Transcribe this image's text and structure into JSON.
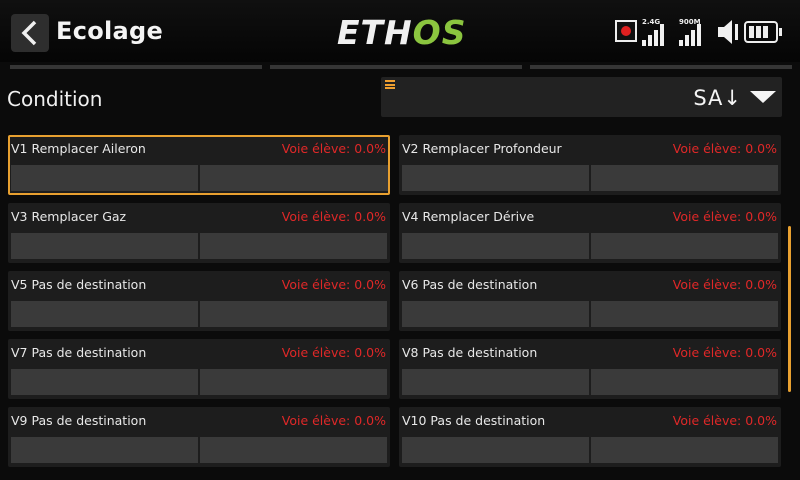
{
  "header": {
    "title": "Ecolage",
    "logo": {
      "main": "ETH",
      "accent": "OS"
    },
    "signal_24": "2.4G",
    "signal_900": "900M"
  },
  "condition": {
    "label": "Condition",
    "value": "SA↓"
  },
  "channels": [
    {
      "name": "V1 Remplacer Aileron",
      "status": "Voie élève: 0.0%"
    },
    {
      "name": "V2 Remplacer Profondeur",
      "status": "Voie élève: 0.0%"
    },
    {
      "name": "V3 Remplacer Gaz",
      "status": "Voie élève: 0.0%"
    },
    {
      "name": "V4 Remplacer Dérive",
      "status": "Voie élève: 0.0%"
    },
    {
      "name": "V5 Pas de destination",
      "status": "Voie élève: 0.0%"
    },
    {
      "name": "V6 Pas de destination",
      "status": "Voie élève: 0.0%"
    },
    {
      "name": "V7 Pas de destination",
      "status": "Voie élève: 0.0%"
    },
    {
      "name": "V8 Pas de destination",
      "status": "Voie élève: 0.0%"
    },
    {
      "name": "V9 Pas de destination",
      "status": "Voie élève: 0.0%"
    },
    {
      "name": "V10 Pas de destination",
      "status": "Voie élève: 0.0%"
    }
  ],
  "colors": {
    "accent": "#e8a030",
    "status_text": "#e02828",
    "logo_accent": "#8bc53f"
  },
  "icons": [
    "back-arrow-icon",
    "record-icon",
    "signal-icon",
    "speaker-icon",
    "battery-icon",
    "menu-icon",
    "dropdown-arrow-icon"
  ]
}
